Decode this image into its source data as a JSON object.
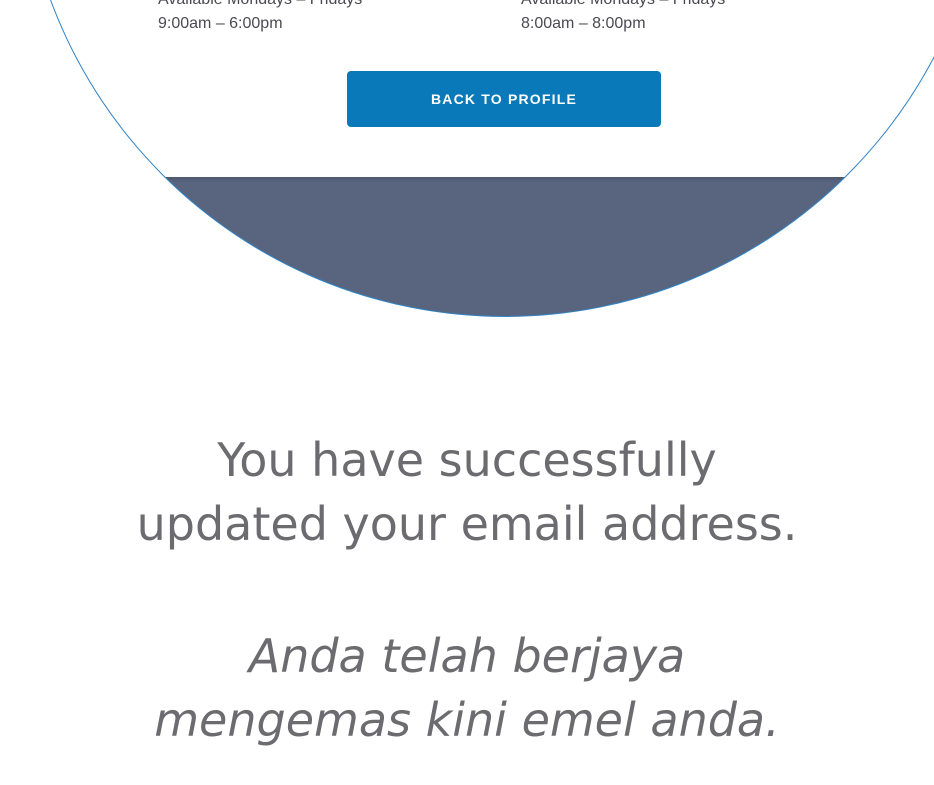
{
  "support_hours": {
    "left": {
      "availability": "Available Mondays – Fridays",
      "time": "9:00am – 6:00pm"
    },
    "right": {
      "availability": "Available Mondays – Fridays",
      "time": "8:00am – 8:00pm"
    }
  },
  "back_button": {
    "label": "BACK TO PROFILE"
  },
  "message": {
    "english": {
      "line1": "You have successfully",
      "line2": "updated your email address."
    },
    "malay": {
      "line1": "Anda telah berjaya",
      "line2": "mengemas kini emel anda."
    }
  },
  "colors": {
    "button_bg": "#0a79b9",
    "magnifier_bg": "#59657f",
    "magnifier_border": "#2f86c9",
    "message_text": "#6b6b70"
  }
}
